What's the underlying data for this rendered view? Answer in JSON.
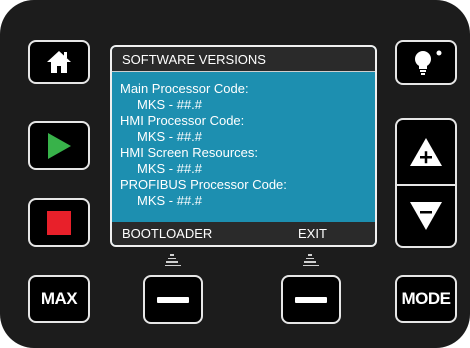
{
  "screen": {
    "title": "SOFTWARE VERSIONS",
    "entries": [
      {
        "label": "Main Processor Code:",
        "value": "MKS - ##.#"
      },
      {
        "label": "HMI Processor Code:",
        "value": "MKS - ##.#"
      },
      {
        "label": "HMI Screen Resources:",
        "value": "MKS - ##.#"
      },
      {
        "label": "PROFIBUS Processor Code:",
        "value": "MKS - ##.#"
      }
    ],
    "softkeys": {
      "left": "BOOTLOADER",
      "right": "EXIT"
    }
  },
  "buttons": {
    "max_label": "MAX",
    "mode_label": "MODE"
  },
  "icons": {
    "home": "home-icon",
    "play": "play-icon",
    "stop": "stop-icon",
    "light": "lightbulb-icon",
    "up": "up-plus-icon",
    "down": "down-minus-icon",
    "softkey": "minus-bar-icon"
  },
  "colors": {
    "screen_background": "#1d8fb0",
    "play_green": "#38b24a",
    "stop_red": "#e8202a"
  }
}
